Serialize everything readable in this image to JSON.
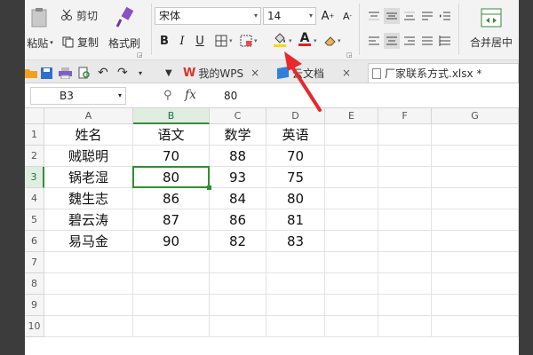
{
  "ribbon": {
    "paste_label": "粘贴",
    "cut_label": "剪切",
    "copy_label": "复制",
    "format_painter_label": "格式刷",
    "font_name": "宋体",
    "font_size": "14",
    "merge_label": "合并居中"
  },
  "tabs": [
    {
      "label": "我的WPS"
    },
    {
      "label": "云文档"
    },
    {
      "label": "厂家联系方式.xlsx *"
    }
  ],
  "formula_bar": {
    "cell_ref": "B3",
    "fx_label": "fx",
    "value": "80"
  },
  "columns": [
    "A",
    "B",
    "C",
    "D",
    "E",
    "F",
    "G"
  ],
  "rows": [
    "1",
    "2",
    "3",
    "4",
    "5",
    "6",
    "7",
    "8",
    "9",
    "10"
  ],
  "table": {
    "headers": [
      "姓名",
      "语文",
      "数学",
      "英语"
    ],
    "data": [
      [
        "贼聪明",
        "70",
        "88",
        "70"
      ],
      [
        "锅老湿",
        "80",
        "93",
        "75"
      ],
      [
        "魏生志",
        "86",
        "84",
        "80"
      ],
      [
        "碧云涛",
        "87",
        "86",
        "81"
      ],
      [
        "易马金",
        "90",
        "82",
        "83"
      ]
    ]
  },
  "colors": {
    "accent_green": "#2f8f2f",
    "highlight_yellow": "#ffd800",
    "font_red": "#e02020",
    "arrow_red": "#e8282a",
    "wps_red": "#d9322b"
  }
}
